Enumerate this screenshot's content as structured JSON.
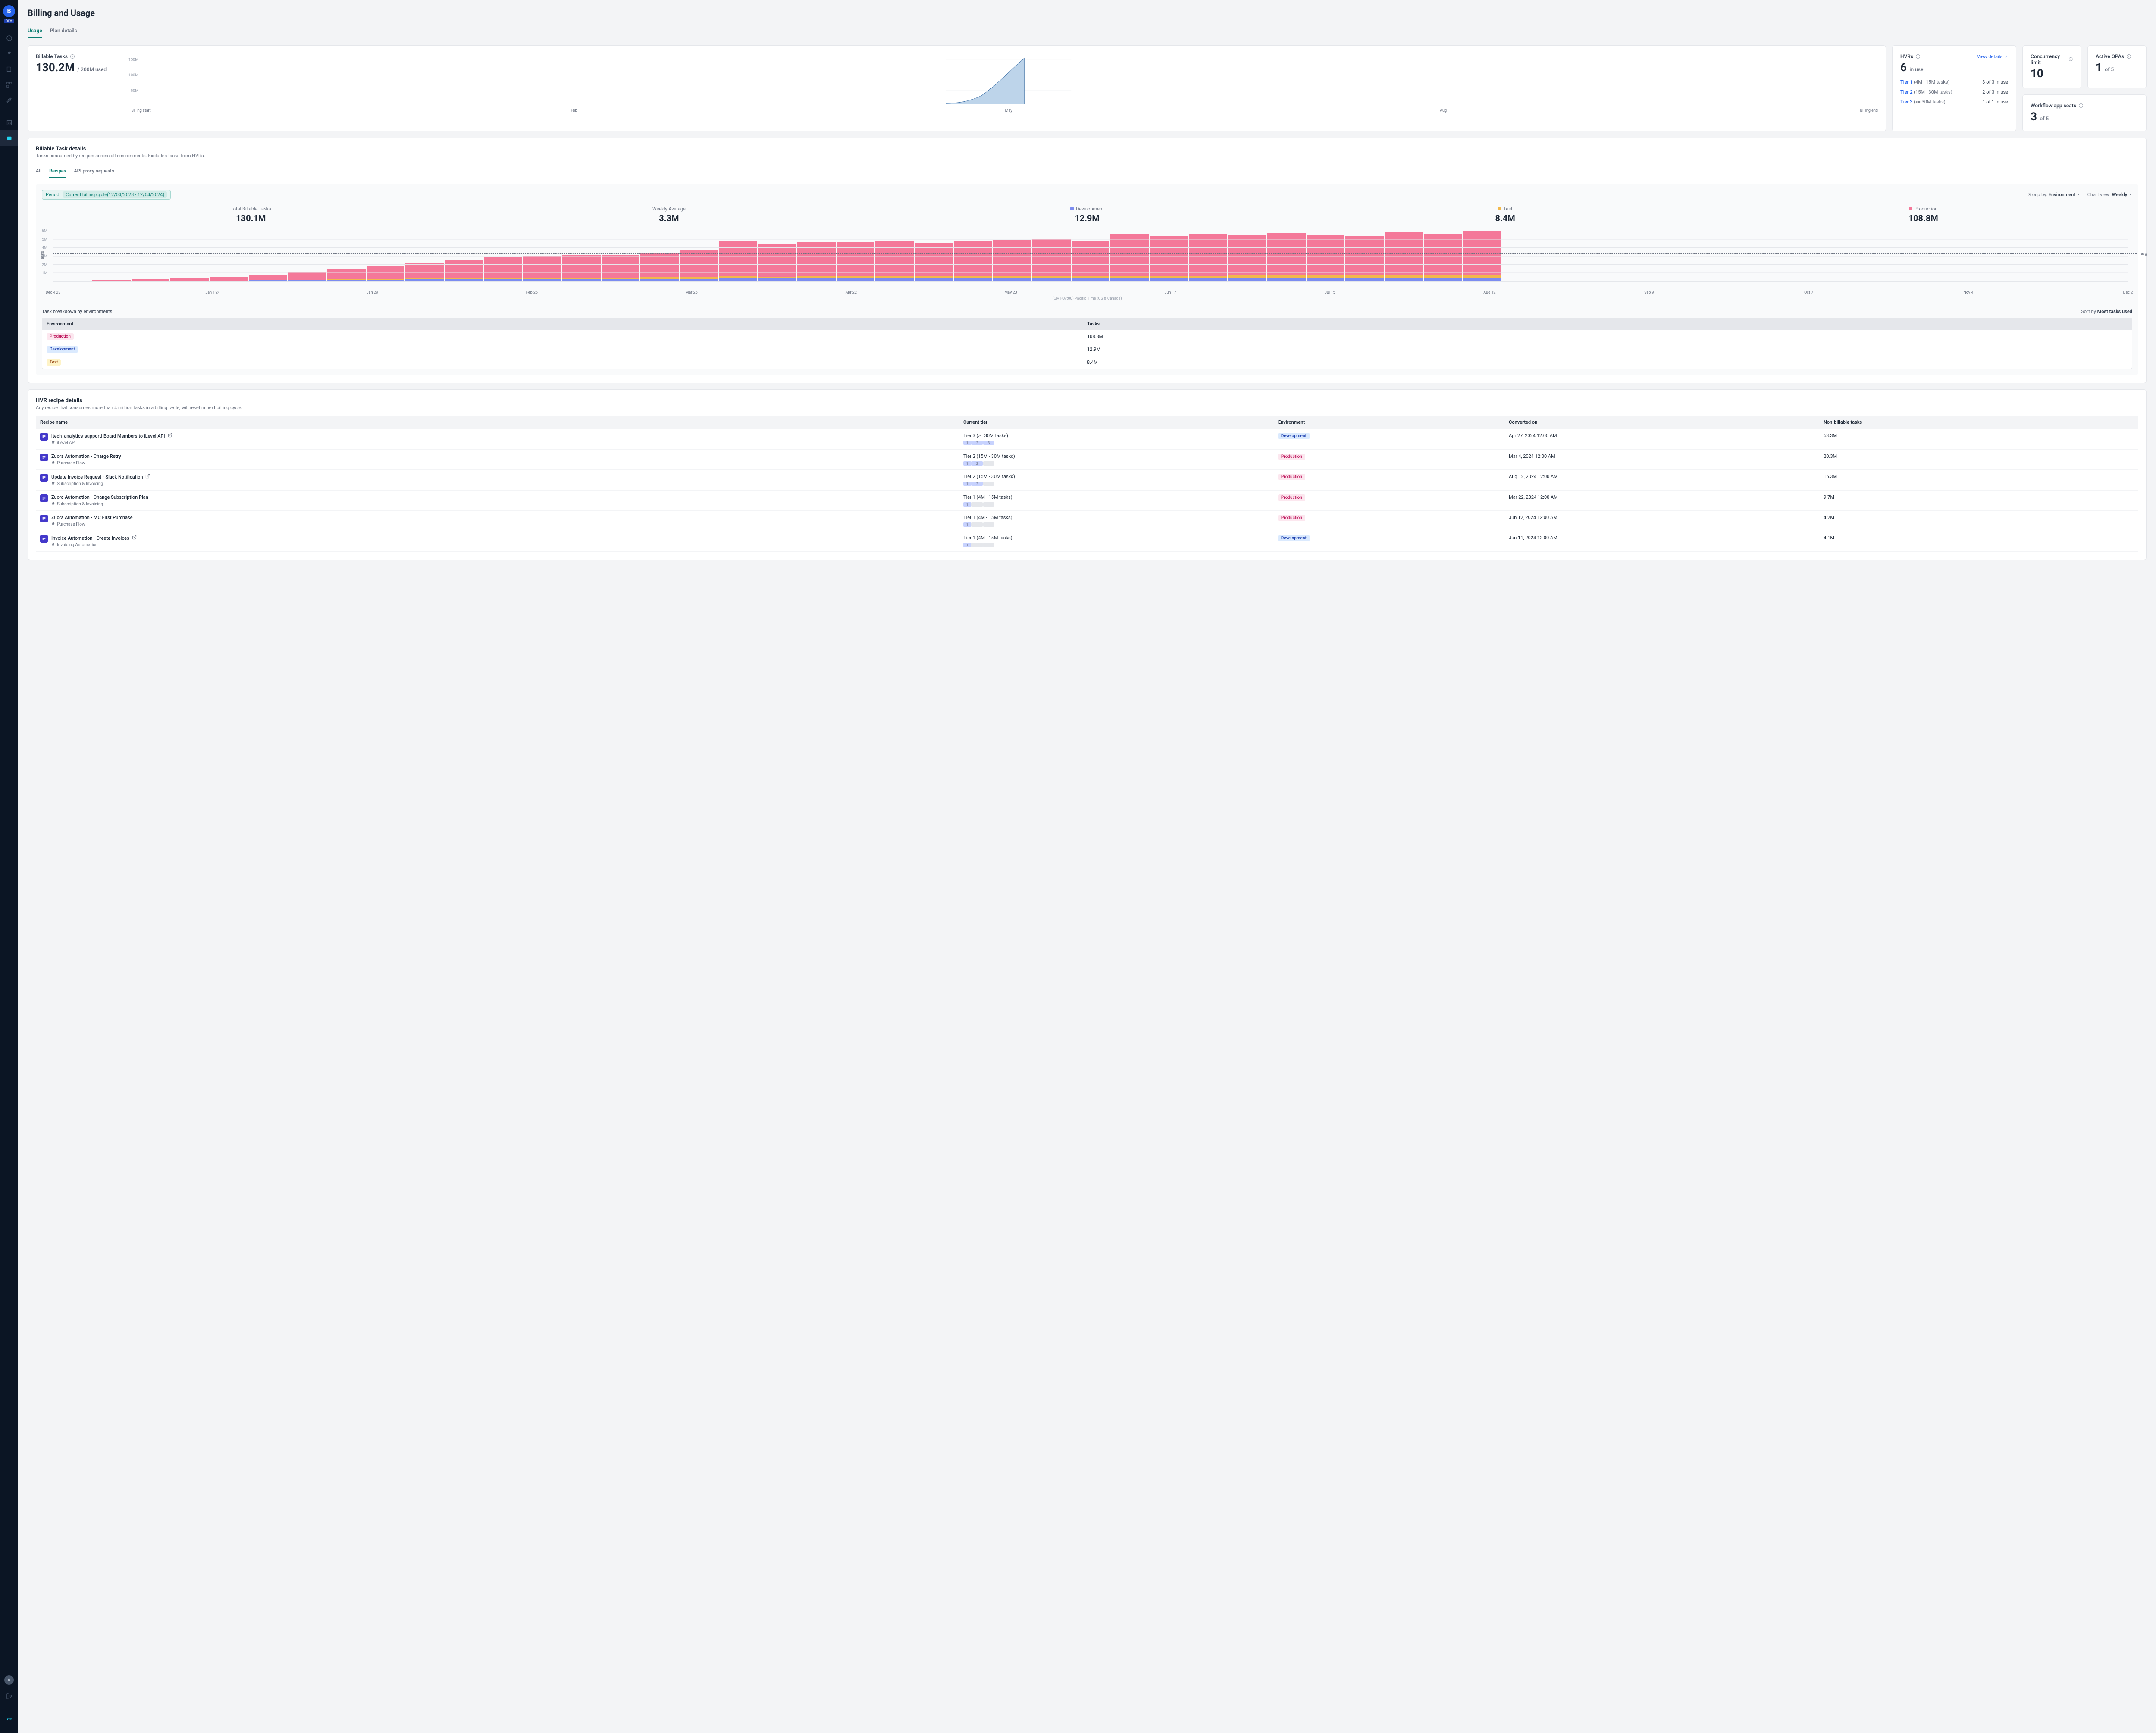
{
  "page": {
    "title": "Billing and Usage"
  },
  "sidebar": {
    "logo_letter": "B",
    "env_badge": "DEV",
    "avatar_letter": "A"
  },
  "tabs": [
    {
      "label": "Usage",
      "active": true
    },
    {
      "label": "Plan details",
      "active": false
    }
  ],
  "billable": {
    "label": "Billable Tasks",
    "value": "130.2M",
    "suffix": "/ 200M used",
    "y_ticks": [
      "150M",
      "100M",
      "50M"
    ],
    "x_ticks": [
      "Billing start",
      "Feb",
      "May",
      "Aug",
      "Billing end"
    ]
  },
  "hvr": {
    "label": "HVRs",
    "value": "6",
    "suffix": "in use",
    "view_link": "View details",
    "tiers": [
      {
        "name": "Tier 1",
        "range": "(4M - 15M tasks)",
        "count": "3 of 3 in use"
      },
      {
        "name": "Tier 2",
        "range": "(15M - 30M tasks)",
        "count": "2 of 3 in use"
      },
      {
        "name": "Tier 3",
        "range": "(>= 30M tasks)",
        "count": "1 of 1 in use"
      }
    ]
  },
  "concurrency": {
    "label": "Concurrency limit",
    "value": "10"
  },
  "opa": {
    "label": "Active OPAs",
    "value": "1",
    "suffix": "of 5"
  },
  "seats": {
    "label": "Workflow app seats",
    "value": "3",
    "suffix": "of 5"
  },
  "details": {
    "title": "Billable Task details",
    "sub": "Tasks consumed by recipes across all environments. Excludes tasks from HVRs.",
    "subtabs": [
      {
        "label": "All",
        "active": false
      },
      {
        "label": "Recipes",
        "active": true
      },
      {
        "label": "API proxy requests",
        "active": false
      }
    ],
    "period_label": "Period:",
    "period_value": "Current billing cycle(12/04/2023 - 12/04/2024)",
    "group_by_label": "Group by:",
    "group_by_value": "Environment",
    "chart_view_label": "Chart view:",
    "chart_view_value": "Weekly",
    "stats": {
      "total": {
        "label": "Total Billable Tasks",
        "value": "130.1M"
      },
      "avg": {
        "label": "Weekly Average",
        "value": "3.3M"
      },
      "dev": {
        "label": "Development",
        "value": "12.9M"
      },
      "test": {
        "label": "Test",
        "value": "8.4M"
      },
      "prod": {
        "label": "Production",
        "value": "108.8M"
      }
    },
    "breakdown_title": "Task breakdown by environments",
    "sort_label": "Sort by",
    "sort_value": "Most tasks used",
    "env_table": {
      "h_env": "Environment",
      "h_tasks": "Tasks",
      "rows": [
        {
          "env": "Production",
          "badge": "prod",
          "tasks": "108.8M"
        },
        {
          "env": "Development",
          "badge": "dev",
          "tasks": "12.9M"
        },
        {
          "env": "Test",
          "badge": "test",
          "tasks": "8.4M"
        }
      ]
    },
    "tz": "(GMT-07:00) Pacific Time (US & Canada)"
  },
  "chart_data": {
    "type": "bar",
    "title": "",
    "ylabel": "Tasks",
    "ylim": [
      0,
      6000000
    ],
    "y_ticks": [
      "6M",
      "5M",
      "4M",
      "3M",
      "2M",
      "1M"
    ],
    "x_ticks": [
      "Dec 4'23",
      "Jan 1'24",
      "Jan 29",
      "Feb 26",
      "Mar 25",
      "Apr 22",
      "May 20",
      "Jun 17",
      "Jul 15",
      "Aug 12",
      "Sep 9",
      "Oct 7",
      "Nov 4",
      "Dec 2"
    ],
    "avg_line": 3300000,
    "avg_label": "avg",
    "weeks": [
      {
        "dev": 0,
        "test": 0,
        "prod": 50000
      },
      {
        "dev": 50000,
        "test": 0,
        "prod": 100000
      },
      {
        "dev": 80000,
        "test": 0,
        "prod": 180000
      },
      {
        "dev": 100000,
        "test": 0,
        "prod": 250000
      },
      {
        "dev": 120000,
        "test": 0,
        "prod": 400000
      },
      {
        "dev": 150000,
        "test": 0,
        "prod": 650000
      },
      {
        "dev": 180000,
        "test": 30000,
        "prod": 900000
      },
      {
        "dev": 200000,
        "test": 50000,
        "prod": 1200000
      },
      {
        "dev": 220000,
        "test": 80000,
        "prod": 1500000
      },
      {
        "dev": 250000,
        "test": 100000,
        "prod": 1800000
      },
      {
        "dev": 270000,
        "test": 120000,
        "prod": 2200000
      },
      {
        "dev": 280000,
        "test": 130000,
        "prod": 2500000
      },
      {
        "dev": 290000,
        "test": 150000,
        "prod": 2600000
      },
      {
        "dev": 300000,
        "test": 160000,
        "prod": 2650000
      },
      {
        "dev": 310000,
        "test": 170000,
        "prod": 2700000
      },
      {
        "dev": 320000,
        "test": 180000,
        "prod": 2900000
      },
      {
        "dev": 330000,
        "test": 190000,
        "prod": 3200000
      },
      {
        "dev": 350000,
        "test": 250000,
        "prod": 4200000
      },
      {
        "dev": 350000,
        "test": 230000,
        "prod": 3900000
      },
      {
        "dev": 360000,
        "test": 240000,
        "prod": 4100000
      },
      {
        "dev": 360000,
        "test": 240000,
        "prod": 4050000
      },
      {
        "dev": 370000,
        "test": 250000,
        "prod": 4200000
      },
      {
        "dev": 370000,
        "test": 250000,
        "prod": 4000000
      },
      {
        "dev": 380000,
        "test": 260000,
        "prod": 4250000
      },
      {
        "dev": 380000,
        "test": 260000,
        "prod": 4300000
      },
      {
        "dev": 390000,
        "test": 270000,
        "prod": 4350000
      },
      {
        "dev": 390000,
        "test": 270000,
        "prod": 4100000
      },
      {
        "dev": 400000,
        "test": 280000,
        "prod": 5000000
      },
      {
        "dev": 400000,
        "test": 280000,
        "prod": 4700000
      },
      {
        "dev": 410000,
        "test": 280000,
        "prod": 5000000
      },
      {
        "dev": 410000,
        "test": 290000,
        "prod": 4800000
      },
      {
        "dev": 420000,
        "test": 290000,
        "prod": 5050000
      },
      {
        "dev": 420000,
        "test": 290000,
        "prod": 4900000
      },
      {
        "dev": 430000,
        "test": 300000,
        "prod": 4700000
      },
      {
        "dev": 430000,
        "test": 300000,
        "prod": 5100000
      },
      {
        "dev": 440000,
        "test": 310000,
        "prod": 4900000
      },
      {
        "dev": 450000,
        "test": 320000,
        "prod": 5300000
      }
    ]
  },
  "hvr_details": {
    "title": "HVR recipe details",
    "sub": "Any recipe that consumes more than 4 million tasks in a billing cycle, will reset in next billing cycle.",
    "headers": {
      "name": "Recipe name",
      "tier": "Current tier",
      "env": "Environment",
      "conv": "Converted on",
      "nb": "Non-billable tasks"
    },
    "rows": [
      {
        "name": "[tech_analytics-support] Board Members to iLevel API",
        "path": "iLevel API",
        "tier_label": "Tier 3 (>= 30M tasks)",
        "tier_level": 3,
        "env": "Development",
        "env_badge": "dev",
        "conv": "Apr 27, 2024 12:00 AM",
        "nb": "53.3M",
        "external": true
      },
      {
        "name": "Zuora Automation - Charge Retry",
        "path": "Purchase Flow",
        "tier_label": "Tier 2 (15M - 30M tasks)",
        "tier_level": 2,
        "env": "Production",
        "env_badge": "prod",
        "conv": "Mar 4, 2024 12:00 AM",
        "nb": "20.3M",
        "external": false
      },
      {
        "name": "Update Invoice Request - Slack Notification",
        "path": "Subscription & Invoicing",
        "tier_label": "Tier 2 (15M - 30M tasks)",
        "tier_level": 2,
        "env": "Production",
        "env_badge": "prod",
        "conv": "Aug 12, 2024 12:00 AM",
        "nb": "15.3M",
        "external": true
      },
      {
        "name": "Zuora Automation - Change Subscription Plan",
        "path": "Subscription & Invoicing",
        "tier_label": "Tier 1 (4M - 15M tasks)",
        "tier_level": 1,
        "env": "Production",
        "env_badge": "prod",
        "conv": "Mar 22, 2024 12:00 AM",
        "nb": "9.7M",
        "external": false
      },
      {
        "name": "Zuora Automation - MC First Purchase",
        "path": "Purchase Flow",
        "tier_label": "Tier 1 (4M - 15M tasks)",
        "tier_level": 1,
        "env": "Production",
        "env_badge": "prod",
        "conv": "Jun 12, 2024 12:00 AM",
        "nb": "4.2M",
        "external": false
      },
      {
        "name": "Invoice Automation - Create Invoices",
        "path": "Invoicing Automation",
        "tier_label": "Tier 1 (4M - 15M tasks)",
        "tier_level": 1,
        "env": "Development",
        "env_badge": "dev",
        "conv": "Jun 11, 2024 12:00 AM",
        "nb": "4.1M",
        "external": true
      }
    ]
  }
}
